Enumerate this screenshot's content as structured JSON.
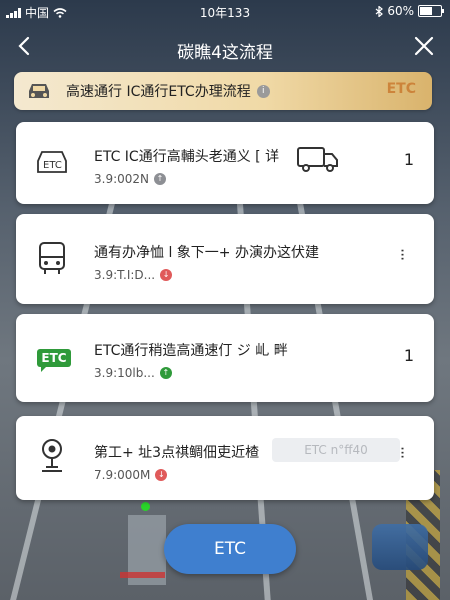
{
  "status_bar": {
    "carrier": "中国",
    "time": "10年133",
    "battery": "60%",
    "battery_level": 0.6
  },
  "nav": {
    "title": "碳瞧4这流程",
    "back_icon": "chevron-left-icon",
    "close_icon": "close-icon"
  },
  "banner": {
    "text": "高速通行 IC通行ETC办理流程",
    "tag": "ETC"
  },
  "cards": [
    {
      "title": "ETC IC通行高輔头老通义 [ 详",
      "sub": "3.9:002N",
      "count": "1",
      "icon": "etc-card-icon",
      "dot_color": "#8d8f94"
    },
    {
      "title": "通有办净恤 l 象下一+ 办演办这伏建",
      "sub": "3.9:T.I:D...",
      "count": "",
      "icon": "bus-icon",
      "dot_color": "#e05a5a"
    },
    {
      "title": "ETC通行稍造高通速仃 ジ 乢 畔",
      "sub": "3.9:10lb...",
      "count": "1",
      "icon": "etc-green-badge",
      "dot_color": "#2f9a3a"
    },
    {
      "title": "第工+ 址3点祺鲷佃吏近楂",
      "sub": "7.9:000M",
      "count": "",
      "icon": "location-pin-icon",
      "dot_color": "#e05a5a",
      "tag": "ETC n°ff40"
    }
  ],
  "bottom_button": {
    "label": "ETC"
  },
  "colors": {
    "accent": "#3f7fcf",
    "banner_gold": "#f0d9a6",
    "etc_green": "#2f9a3a"
  }
}
